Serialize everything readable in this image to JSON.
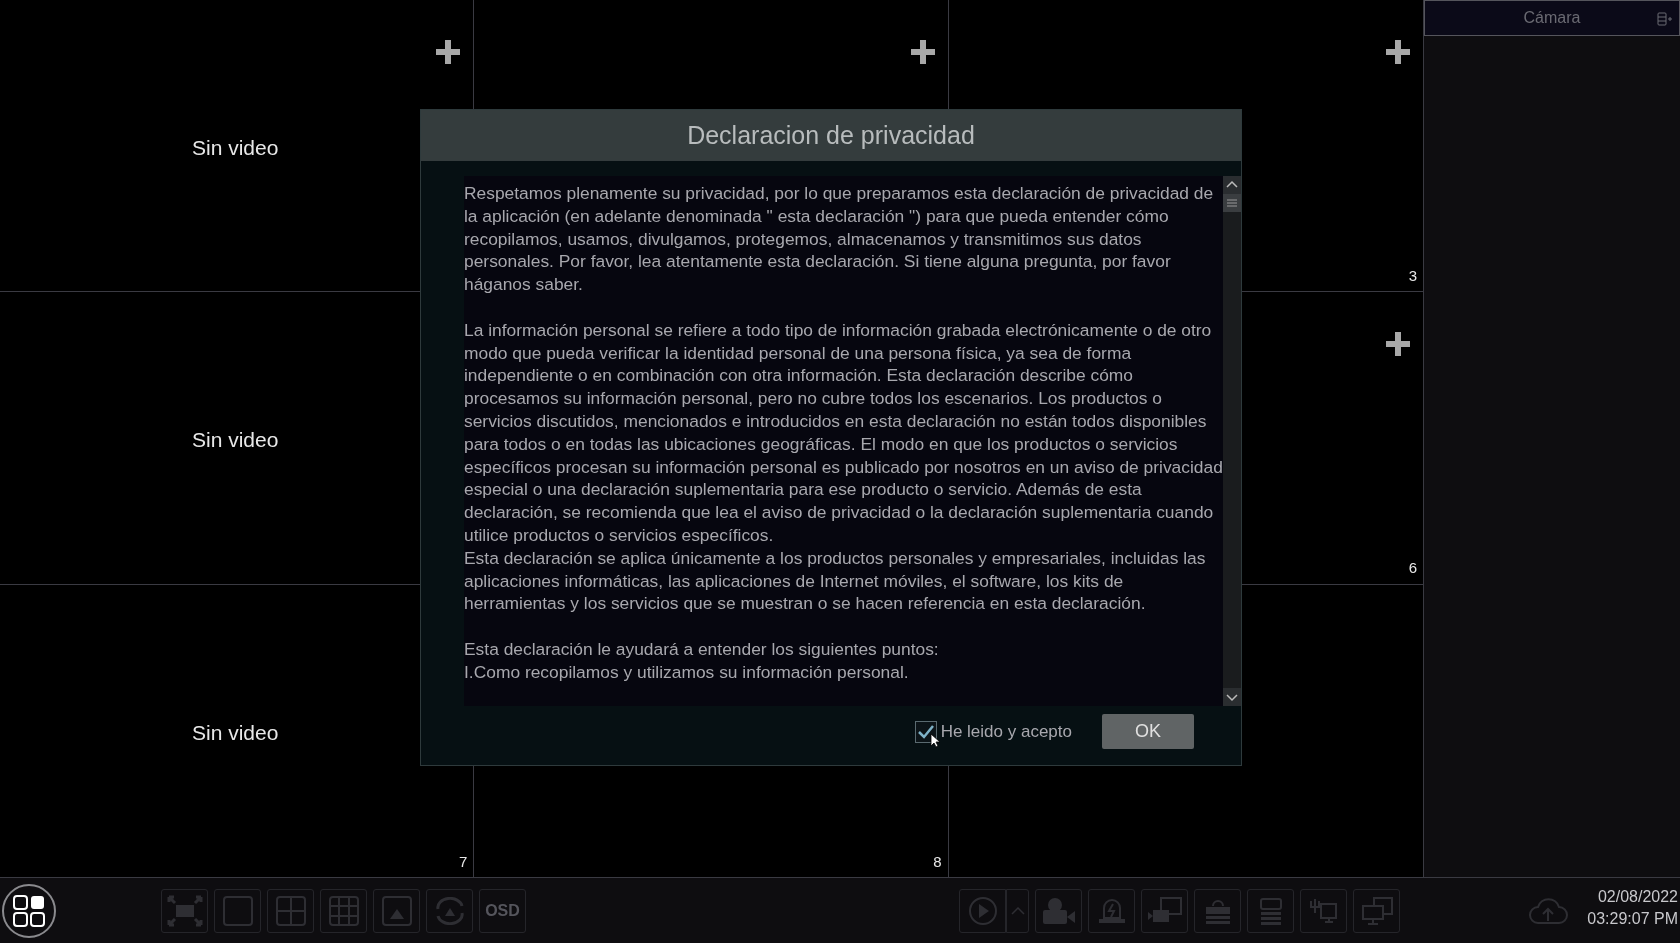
{
  "cells": [
    {
      "label": "Sin video",
      "add": true
    },
    {
      "add": true
    },
    {
      "add": true,
      "number": "3"
    },
    {
      "label": "Sin video"
    },
    {},
    {
      "add": true,
      "number": "6"
    },
    {
      "label": "Sin video",
      "number": "7"
    },
    {
      "number": "8"
    },
    {
      "add": false
    }
  ],
  "side_panel": {
    "title": "Cámara"
  },
  "dialog": {
    "title": "Declaracion de privacidad",
    "sections": [
      [
        "Respetamos plenamente su privacidad, por lo que preparamos esta declaración de privacidad de la aplicación (en adelante denominada \" esta declaración \") para que pueda entender cómo recopilamos, usamos, divulgamos, protegemos, almacenamos y transmitimos sus datos personales. Por favor, lea atentamente esta declaración. Si tiene alguna pregunta, por favor háganos saber."
      ],
      [
        "La información personal se refiere a todo tipo de información grabada electrónicamente o de otro modo que pueda verificar la identidad personal de una persona física, ya sea de forma independiente o en combinación con otra información. Esta declaración describe cómo procesamos su información personal, pero no cubre todos los escenarios. Los productos o servicios discutidos, mencionados e introducidos en esta declaración no están todos disponibles para todos o en todas las ubicaciones geográficas. El modo en que los productos o servicios específicos procesan su información personal es publicado por nosotros en un aviso de privacidad especial o una declaración suplementaria para ese producto o servicio. Además de esta declaración, se recomienda que lea el aviso de privacidad o la declaración suplementaria cuando utilice productos o servicios específicos.",
        "Esta declaración se aplica únicamente a los productos personales y empresariales, incluidas las aplicaciones informáticas, las aplicaciones de Internet móviles, el software, los kits de herramientas y los servicios que se muestran o  se hacen referencia en esta declaración."
      ],
      [
        "Esta declaración le ayudará a entender los siguientes puntos:",
        "I.Como recopilamos y utilizamos su información personal."
      ]
    ],
    "agree": {
      "label": "He leido y acepto",
      "checked": true
    },
    "ok_button": "OK"
  },
  "toolbar": {
    "osd_label": "OSD",
    "date": "02/08/2022",
    "time": "03:29:07 PM"
  }
}
